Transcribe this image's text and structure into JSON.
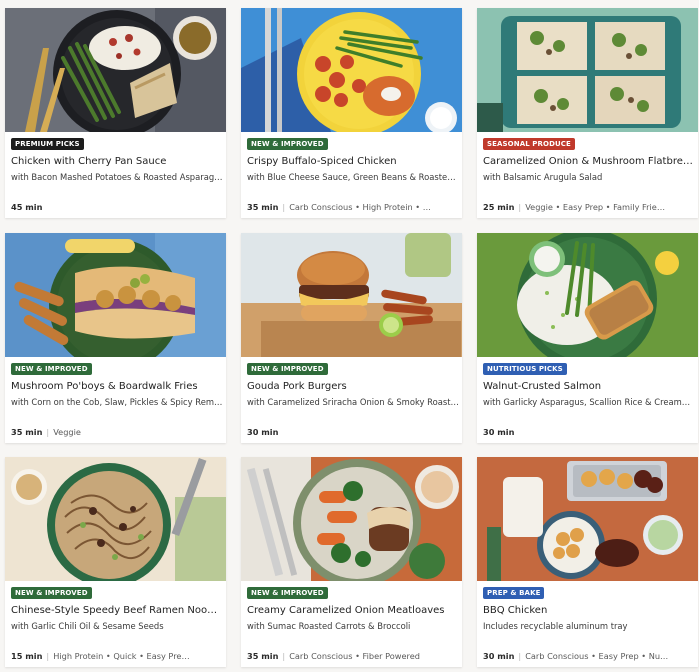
{
  "colors": {
    "badge_dark": "#1c1c1c",
    "badge_green": "#2f6b3a",
    "badge_red": "#c0392b",
    "badge_blue": "#2f5fb3",
    "background": "#f7f6f4"
  },
  "recipes": [
    {
      "badge": "PREMIUM PICKS",
      "badge_color": "#1c1c1c",
      "title": "Chicken with Cherry Pan Sauce",
      "subtitle": "with Bacon Mashed Potatoes & Roasted Asparagus",
      "time": "45 min",
      "tags": ""
    },
    {
      "badge": "NEW & IMPROVED",
      "badge_color": "#2f6b3a",
      "title": "Crispy Buffalo-Spiced Chicken",
      "subtitle": "with Blue Cheese Sauce, Green Beans & Roasted Ca…",
      "time": "35 min",
      "tags": "Carb Conscious • High Protein • …"
    },
    {
      "badge": "SEASONAL PRODUCE",
      "badge_color": "#c0392b",
      "title": "Caramelized Onion & Mushroom Flatbreads",
      "subtitle": "with Balsamic Arugula Salad",
      "time": "25 min",
      "tags": "Veggie • Easy Prep • Family Frie…"
    },
    {
      "badge": "NEW & IMPROVED",
      "badge_color": "#2f6b3a",
      "title": "Mushroom Po'boys & Boardwalk Fries",
      "subtitle": "with Corn on the Cob, Slaw, Pickles & Spicy Remoul…",
      "time": "35 min",
      "tags": "Veggie"
    },
    {
      "badge": "NEW & IMPROVED",
      "badge_color": "#2f6b3a",
      "title": "Gouda Pork Burgers",
      "subtitle": "with Caramelized Sriracha Onion & Smoky Roasted …",
      "time": "30 min",
      "tags": ""
    },
    {
      "badge": "NUTRITIOUS PICKS",
      "badge_color": "#2f5fb3",
      "title": "Walnut-Crusted Salmon",
      "subtitle": "with Garlicky Asparagus, Scallion Rice & Creamy Le…",
      "time": "30 min",
      "tags": ""
    },
    {
      "badge": "NEW & IMPROVED",
      "badge_color": "#2f6b3a",
      "title": "Chinese-Style Speedy Beef Ramen Noodles",
      "subtitle": "with Garlic Chili Oil & Sesame Seeds",
      "time": "15 min",
      "tags": "High Protein • Quick • Easy Pre…"
    },
    {
      "badge": "NEW & IMPROVED",
      "badge_color": "#2f6b3a",
      "title": "Creamy Caramelized Onion Meatloaves",
      "subtitle": "with Sumac Roasted Carrots & Broccoli",
      "time": "35 min",
      "tags": "Carb Conscious • Fiber Powered"
    },
    {
      "badge": "PREP & BAKE",
      "badge_color": "#2f5fb3",
      "title": "BBQ Chicken",
      "subtitle": "Includes recyclable aluminum tray",
      "time": "30 min",
      "tags": "Carb Conscious • Easy Prep • Nu…"
    }
  ]
}
